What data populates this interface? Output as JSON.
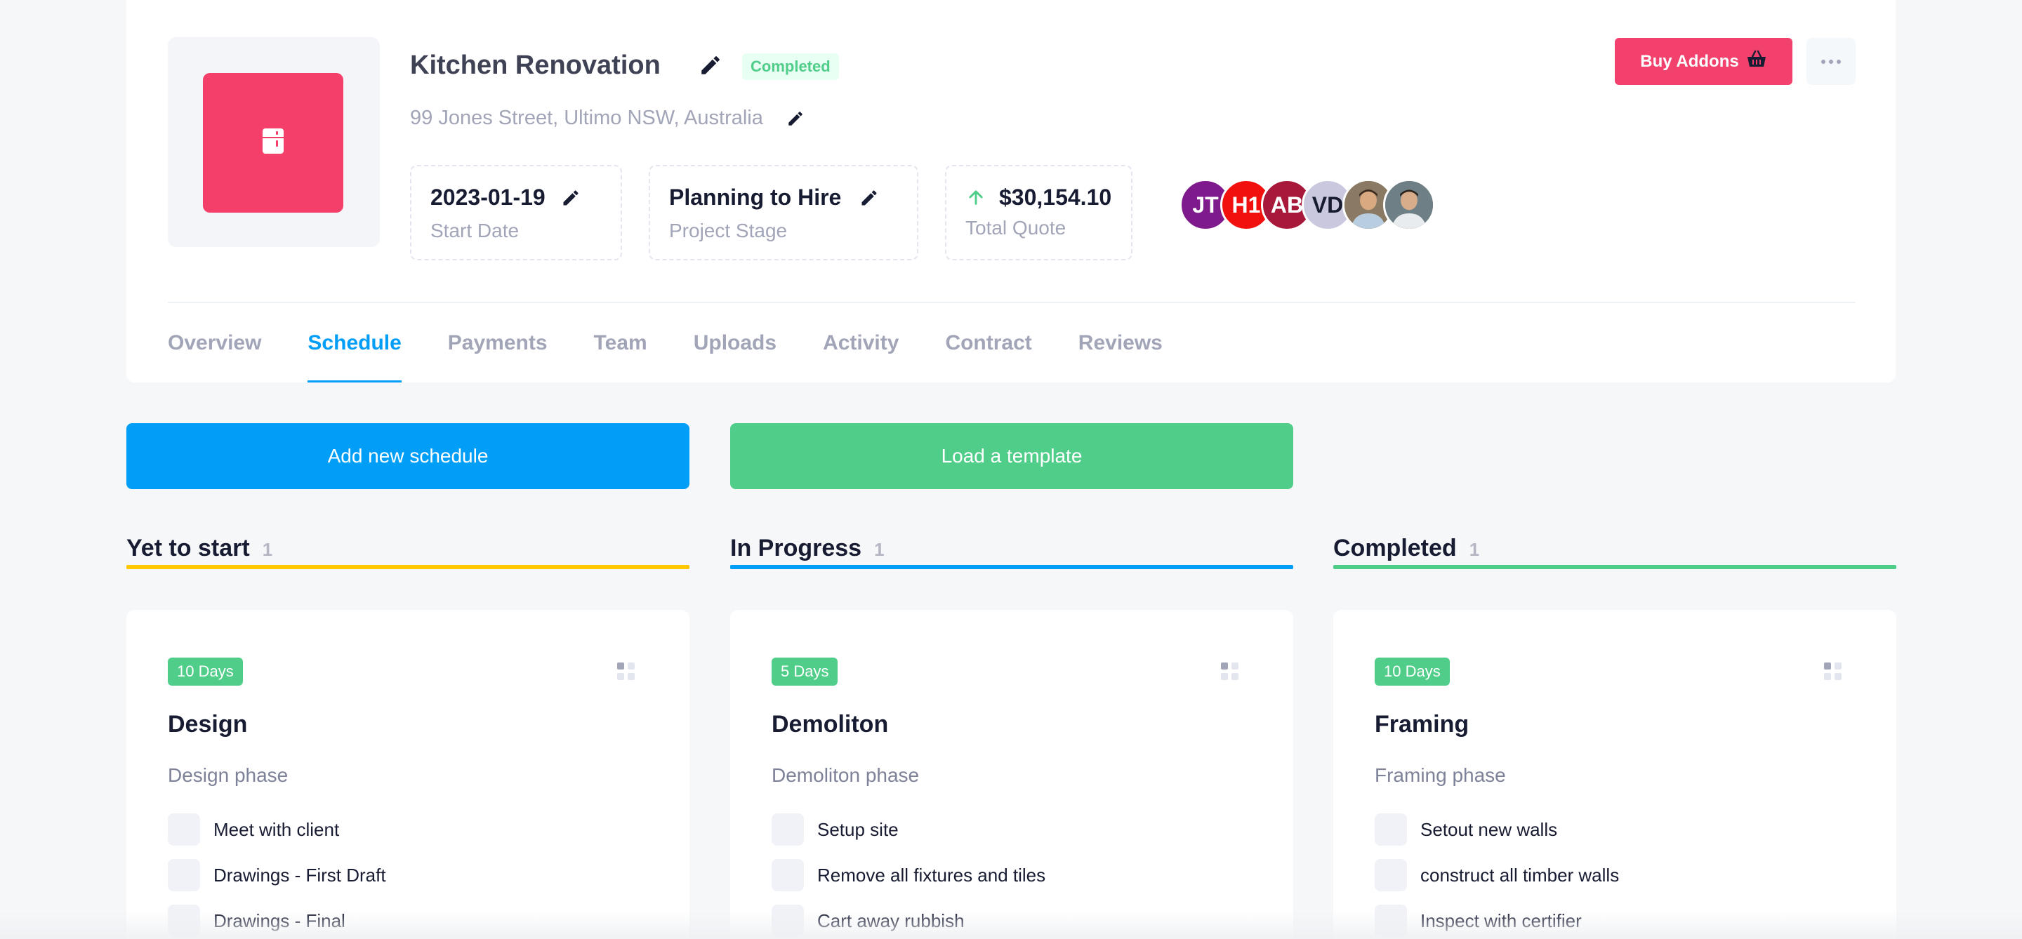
{
  "project": {
    "title": "Kitchen Renovation",
    "status": "Completed",
    "address": "99 Jones Street, Ultimo NSW, Australia",
    "thumbnail_icon": "fridge-icon",
    "accent_color": "#f43f6a"
  },
  "stats": [
    {
      "value": "2023-01-19",
      "label": "Start Date"
    },
    {
      "value": "Planning to Hire",
      "label": "Project Stage"
    },
    {
      "value": "$30,154.10",
      "label": "Total Quote",
      "icon": "arrow-up-icon"
    }
  ],
  "team_avatars": [
    {
      "initials": "JT",
      "color": "#7e1a8c"
    },
    {
      "initials": "H1",
      "color": "#f1100e"
    },
    {
      "initials": "AB",
      "color": "#a8183a"
    },
    {
      "initials": "VD",
      "color": "#c9c8de"
    },
    {
      "initials": "",
      "color": "#8a7a64",
      "photo": true
    },
    {
      "initials": "",
      "color": "#6e7f86",
      "photo": true
    }
  ],
  "header_actions": {
    "buy_addons": "Buy Addons",
    "buy_addons_icon": "basket-icon",
    "more_icon": "more-horizontal-icon"
  },
  "tabs": [
    {
      "label": "Overview",
      "active": false
    },
    {
      "label": "Schedule",
      "active": true
    },
    {
      "label": "Payments",
      "active": false
    },
    {
      "label": "Team",
      "active": false
    },
    {
      "label": "Uploads",
      "active": false
    },
    {
      "label": "Activity",
      "active": false
    },
    {
      "label": "Contract",
      "active": false
    },
    {
      "label": "Reviews",
      "active": false
    }
  ],
  "actions": {
    "add_schedule": "Add new schedule",
    "load_template": "Load a template"
  },
  "columns": [
    {
      "title": "Yet to start",
      "count": "1",
      "color": "#ffc700",
      "card": {
        "days": "10 Days",
        "title": "Design",
        "subtitle": "Design phase",
        "tasks": [
          "Meet with client",
          "Drawings - First Draft",
          "Drawings - Final"
        ]
      }
    },
    {
      "title": "In Progress",
      "count": "1",
      "color": "#009ef7",
      "card": {
        "days": "5 Days",
        "title": "Demoliton",
        "subtitle": "Demoliton phase",
        "tasks": [
          "Setup site",
          "Remove all fixtures and tiles",
          "Cart away rubbish"
        ]
      }
    },
    {
      "title": "Completed",
      "count": "1",
      "color": "#50cd89",
      "card": {
        "days": "10 Days",
        "title": "Framing",
        "subtitle": "Framing phase",
        "tasks": [
          "Setout new walls",
          "construct all timber walls",
          "Inspect with certifier"
        ]
      }
    }
  ]
}
